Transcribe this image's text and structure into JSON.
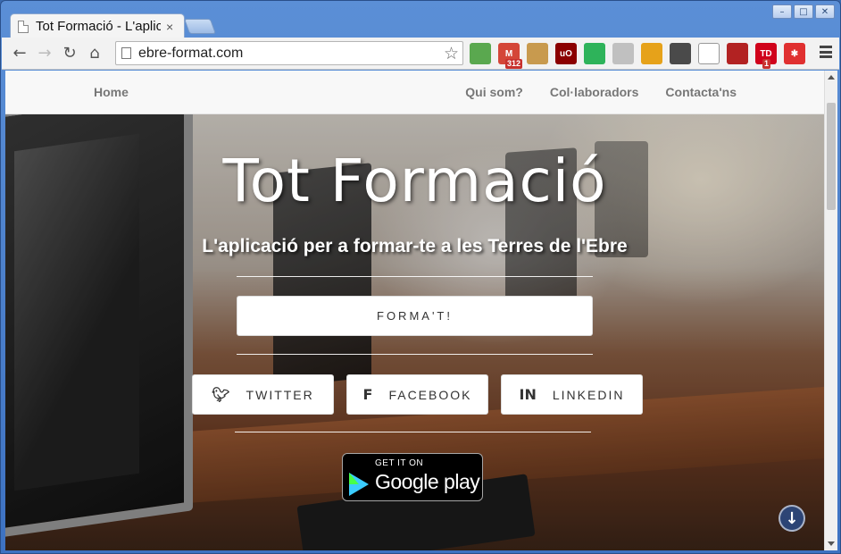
{
  "browser": {
    "tab_title": "Tot Formació - L'aplicació per a formar-te a les Terres de l'Ebre",
    "tab_close": "×",
    "url": "ebre-format.com",
    "controls": {
      "minimize": "–",
      "maximize": "□",
      "close": "✕"
    },
    "nav": {
      "back": "←",
      "forward": "→",
      "reload": "↻",
      "home": "⌂",
      "star": "☆"
    },
    "extensions": [
      {
        "name": "evernote-ext-icon",
        "color": "#5aa84f",
        "label": ""
      },
      {
        "name": "gmail-ext-icon",
        "color": "#d44638",
        "label": "M",
        "badge": "312"
      },
      {
        "name": "feedly-ext-icon",
        "color": "#c89a4e",
        "label": ""
      },
      {
        "name": "ublock-ext-icon",
        "color": "#8b0000",
        "label": "uO"
      },
      {
        "name": "green-circle-ext-icon",
        "color": "#2eb35a",
        "label": ""
      },
      {
        "name": "shield-ext-icon",
        "color": "#c0c0c0",
        "label": ""
      },
      {
        "name": "colorful-ext-icon",
        "color": "#e6a21a",
        "label": ""
      },
      {
        "name": "folder-ext-icon",
        "color": "#4a4a4a",
        "label": ""
      },
      {
        "name": "cloud-ext-icon",
        "color": "#ffffff",
        "label": ""
      },
      {
        "name": "couch-ext-icon",
        "color": "#b22222",
        "label": ""
      },
      {
        "name": "todo-ext-icon",
        "color": "#d0021b",
        "label": "TD",
        "badge": "1"
      },
      {
        "name": "asterisk-ext-icon",
        "color": "#e03030",
        "label": "✱"
      }
    ]
  },
  "site": {
    "nav": {
      "home": "Home",
      "about": "Qui som?",
      "collaborators": "Col·laboradors",
      "contact": "Contacta'ns"
    },
    "hero": {
      "title": "Tot Formació",
      "subtitle": "L'aplicació per a formar-te a les Terres de l'Ebre",
      "cta": "FORMA'T!",
      "social": {
        "twitter": "TWITTER",
        "facebook": "FACEBOOK",
        "linkedin": "LINKEDIN"
      },
      "gplay_small": "GET IT ON",
      "gplay_big": "Google play",
      "scroll_arrow": "↓"
    }
  }
}
